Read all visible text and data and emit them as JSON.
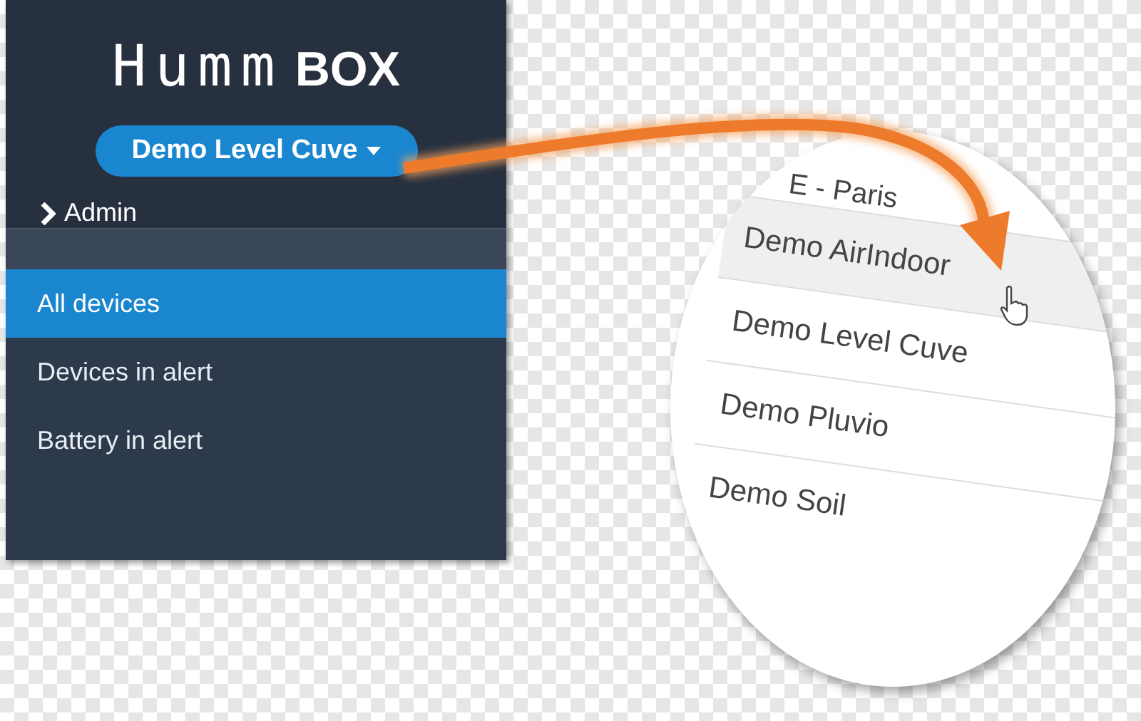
{
  "logo": {
    "word": "Humm",
    "suffix": "BOX"
  },
  "site_button": {
    "label": "Demo Level Cuve"
  },
  "admin_link": {
    "label": "Admin"
  },
  "sidebar": {
    "items": [
      {
        "label": "All devices",
        "selected": true
      },
      {
        "label": "Devices in alert",
        "selected": false
      },
      {
        "label": "Battery in alert",
        "selected": false
      }
    ]
  },
  "magnified_list": {
    "header": "E - Paris",
    "items": [
      {
        "label": "Demo AirIndoor",
        "highlighted": true
      },
      {
        "label": "Demo Level Cuve",
        "highlighted": false
      },
      {
        "label": "Demo Pluvio",
        "highlighted": false
      },
      {
        "label": "Demo Soil",
        "highlighted": false
      }
    ]
  }
}
